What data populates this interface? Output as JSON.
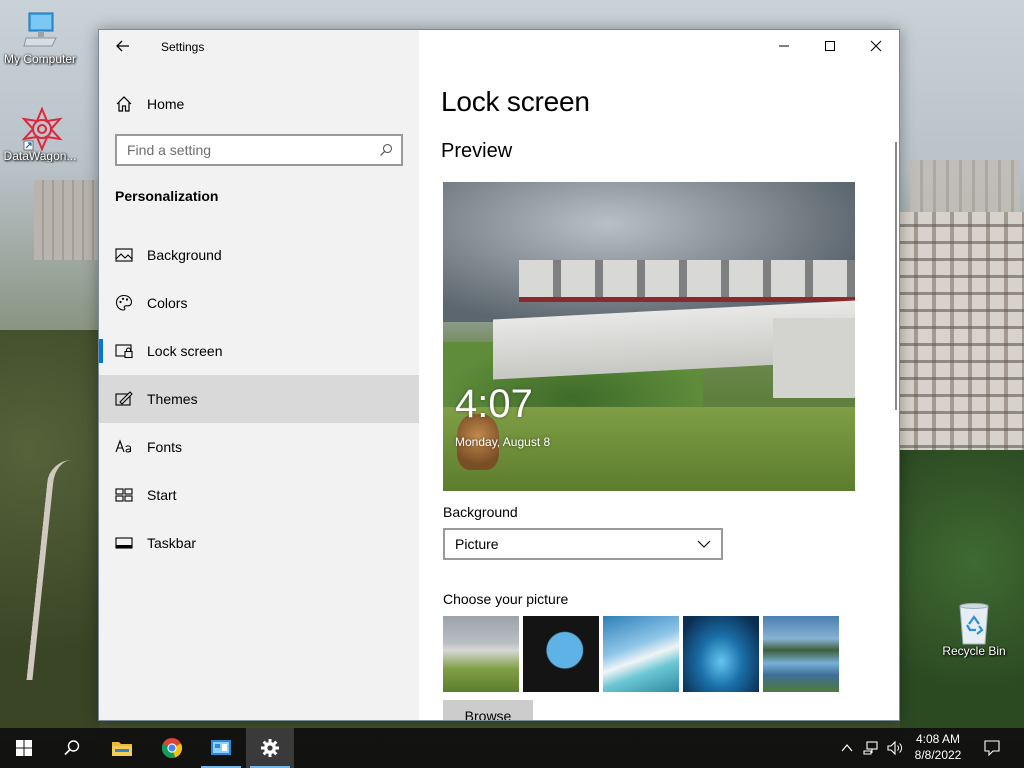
{
  "desktop": {
    "icons": [
      {
        "label": "My Computer"
      },
      {
        "label": "DataWagon..."
      },
      {
        "label": "Recycle Bin"
      }
    ]
  },
  "window": {
    "app_title": "Settings",
    "sidebar": {
      "home_label": "Home",
      "search_placeholder": "Find a setting",
      "section_title": "Personalization",
      "items": [
        {
          "label": "Background",
          "icon": "picture-icon"
        },
        {
          "label": "Colors",
          "icon": "palette-icon"
        },
        {
          "label": "Lock screen",
          "icon": "lock-screen-icon",
          "selected": true
        },
        {
          "label": "Themes",
          "icon": "themes-icon",
          "hovered": true
        },
        {
          "label": "Fonts",
          "icon": "fonts-icon"
        },
        {
          "label": "Start",
          "icon": "start-icon"
        },
        {
          "label": "Taskbar",
          "icon": "taskbar-icon"
        }
      ]
    },
    "content": {
      "page_title": "Lock screen",
      "preview_title": "Preview",
      "preview_time": "4:07",
      "preview_date": "Monday, August 8",
      "background_label": "Background",
      "background_value": "Picture",
      "choose_label": "Choose your picture",
      "browse_label": "Browse"
    }
  },
  "taskbar": {
    "clock_time": "4:08 AM",
    "clock_date": "8/8/2022"
  },
  "colors": {
    "accent": "#0078d7",
    "sidebar_bg": "#f2f2f2",
    "taskbar_bg": "#101010"
  }
}
